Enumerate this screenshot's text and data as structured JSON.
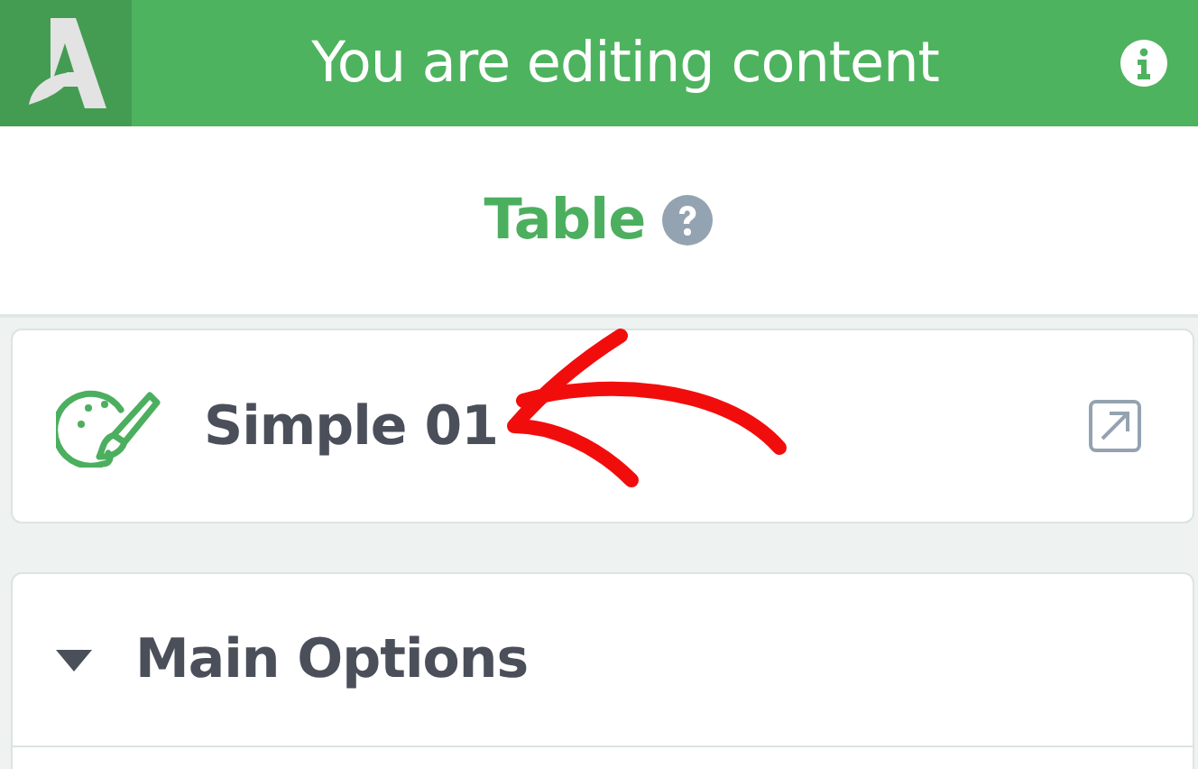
{
  "header": {
    "title": "You are editing content"
  },
  "module": {
    "title": "Table"
  },
  "block": {
    "name": "Simple 01"
  },
  "sections": [
    {
      "label": "Main Options",
      "expanded": true
    }
  ]
}
